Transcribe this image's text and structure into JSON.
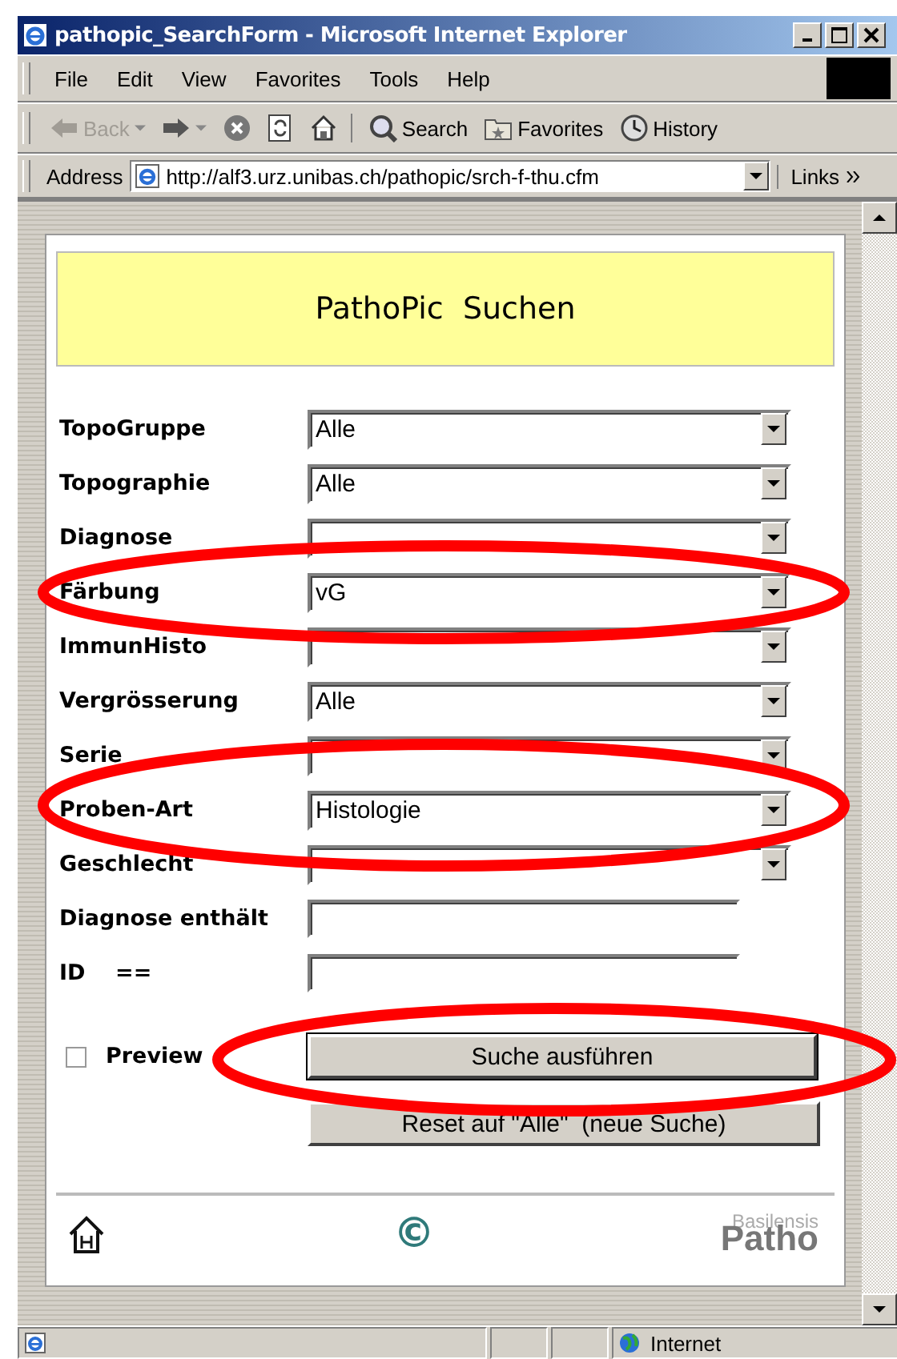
{
  "window": {
    "title": "pathopic_SearchForm - Microsoft Internet Explorer"
  },
  "menu": [
    "File",
    "Edit",
    "View",
    "Favorites",
    "Tools",
    "Help"
  ],
  "toolbar": [
    {
      "kind": "back",
      "label": "Back",
      "disabled": true
    },
    {
      "kind": "forward"
    },
    {
      "kind": "stop"
    },
    {
      "kind": "refresh"
    },
    {
      "kind": "home"
    },
    {
      "kind": "search",
      "label": "Search"
    },
    {
      "kind": "favorites",
      "label": "Favorites"
    },
    {
      "kind": "history",
      "label": "History"
    }
  ],
  "address": {
    "label": "Address",
    "url": "http://alf3.urz.unibas.ch/pathopic/srch-f-thu.cfm",
    "links": "Links"
  },
  "page": {
    "heading": "PathoPic  Suchen",
    "fields": [
      {
        "label": "TopoGruppe",
        "kind": "select",
        "value": "Alle"
      },
      {
        "label": "Topographie",
        "kind": "select",
        "value": "Alle"
      },
      {
        "label": "Diagnose",
        "kind": "select"
      },
      {
        "label": "Färbung",
        "kind": "select",
        "value": "vG"
      },
      {
        "label": "ImmunHisto",
        "kind": "select"
      },
      {
        "label": "Vergrösserung",
        "kind": "select",
        "value": "Alle"
      },
      {
        "label": "Serie",
        "kind": "select"
      },
      {
        "label": "Proben-Art",
        "kind": "select",
        "value": "Histologie"
      },
      {
        "label": "Geschlecht",
        "kind": "select"
      },
      {
        "label": "Diagnose enthält",
        "kind": "text"
      },
      {
        "label": "ID    ==",
        "kind": "text"
      }
    ],
    "preview": {
      "label": "Preview",
      "checked": false
    },
    "buttons": [
      "Suche ausführen",
      "Reset auf \"Alle\"  (neue Suche)"
    ],
    "footer": {
      "copyright": "©",
      "logo_top": "Basilensis",
      "logo_main": "Patho"
    }
  },
  "status_bar": {
    "zone": "Internet"
  }
}
